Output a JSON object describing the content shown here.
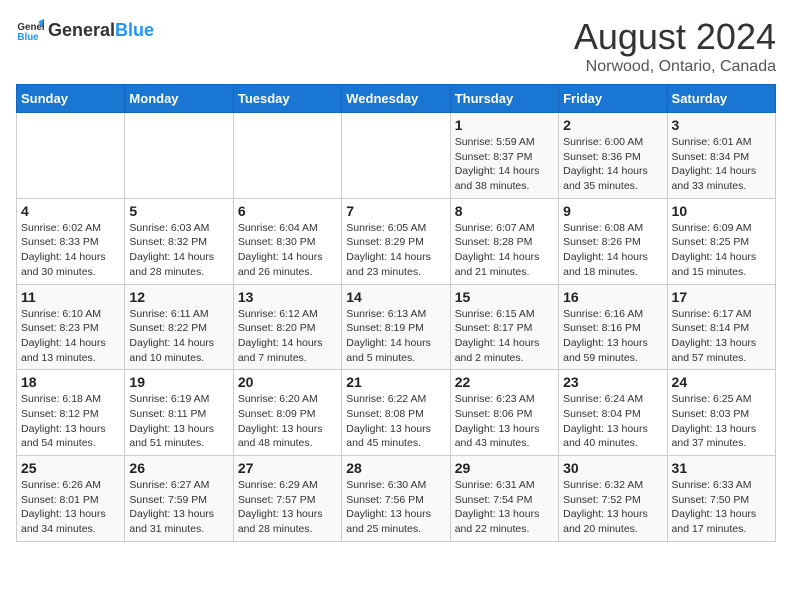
{
  "header": {
    "logo_general": "General",
    "logo_blue": "Blue",
    "title": "August 2024",
    "subtitle": "Norwood, Ontario, Canada"
  },
  "calendar": {
    "days_of_week": [
      "Sunday",
      "Monday",
      "Tuesday",
      "Wednesday",
      "Thursday",
      "Friday",
      "Saturday"
    ],
    "weeks": [
      [
        {
          "day": "",
          "info": ""
        },
        {
          "day": "",
          "info": ""
        },
        {
          "day": "",
          "info": ""
        },
        {
          "day": "",
          "info": ""
        },
        {
          "day": "1",
          "info": "Sunrise: 5:59 AM\nSunset: 8:37 PM\nDaylight: 14 hours\nand 38 minutes."
        },
        {
          "day": "2",
          "info": "Sunrise: 6:00 AM\nSunset: 8:36 PM\nDaylight: 14 hours\nand 35 minutes."
        },
        {
          "day": "3",
          "info": "Sunrise: 6:01 AM\nSunset: 8:34 PM\nDaylight: 14 hours\nand 33 minutes."
        }
      ],
      [
        {
          "day": "4",
          "info": "Sunrise: 6:02 AM\nSunset: 8:33 PM\nDaylight: 14 hours\nand 30 minutes."
        },
        {
          "day": "5",
          "info": "Sunrise: 6:03 AM\nSunset: 8:32 PM\nDaylight: 14 hours\nand 28 minutes."
        },
        {
          "day": "6",
          "info": "Sunrise: 6:04 AM\nSunset: 8:30 PM\nDaylight: 14 hours\nand 26 minutes."
        },
        {
          "day": "7",
          "info": "Sunrise: 6:05 AM\nSunset: 8:29 PM\nDaylight: 14 hours\nand 23 minutes."
        },
        {
          "day": "8",
          "info": "Sunrise: 6:07 AM\nSunset: 8:28 PM\nDaylight: 14 hours\nand 21 minutes."
        },
        {
          "day": "9",
          "info": "Sunrise: 6:08 AM\nSunset: 8:26 PM\nDaylight: 14 hours\nand 18 minutes."
        },
        {
          "day": "10",
          "info": "Sunrise: 6:09 AM\nSunset: 8:25 PM\nDaylight: 14 hours\nand 15 minutes."
        }
      ],
      [
        {
          "day": "11",
          "info": "Sunrise: 6:10 AM\nSunset: 8:23 PM\nDaylight: 14 hours\nand 13 minutes."
        },
        {
          "day": "12",
          "info": "Sunrise: 6:11 AM\nSunset: 8:22 PM\nDaylight: 14 hours\nand 10 minutes."
        },
        {
          "day": "13",
          "info": "Sunrise: 6:12 AM\nSunset: 8:20 PM\nDaylight: 14 hours\nand 7 minutes."
        },
        {
          "day": "14",
          "info": "Sunrise: 6:13 AM\nSunset: 8:19 PM\nDaylight: 14 hours\nand 5 minutes."
        },
        {
          "day": "15",
          "info": "Sunrise: 6:15 AM\nSunset: 8:17 PM\nDaylight: 14 hours\nand 2 minutes."
        },
        {
          "day": "16",
          "info": "Sunrise: 6:16 AM\nSunset: 8:16 PM\nDaylight: 13 hours\nand 59 minutes."
        },
        {
          "day": "17",
          "info": "Sunrise: 6:17 AM\nSunset: 8:14 PM\nDaylight: 13 hours\nand 57 minutes."
        }
      ],
      [
        {
          "day": "18",
          "info": "Sunrise: 6:18 AM\nSunset: 8:12 PM\nDaylight: 13 hours\nand 54 minutes."
        },
        {
          "day": "19",
          "info": "Sunrise: 6:19 AM\nSunset: 8:11 PM\nDaylight: 13 hours\nand 51 minutes."
        },
        {
          "day": "20",
          "info": "Sunrise: 6:20 AM\nSunset: 8:09 PM\nDaylight: 13 hours\nand 48 minutes."
        },
        {
          "day": "21",
          "info": "Sunrise: 6:22 AM\nSunset: 8:08 PM\nDaylight: 13 hours\nand 45 minutes."
        },
        {
          "day": "22",
          "info": "Sunrise: 6:23 AM\nSunset: 8:06 PM\nDaylight: 13 hours\nand 43 minutes."
        },
        {
          "day": "23",
          "info": "Sunrise: 6:24 AM\nSunset: 8:04 PM\nDaylight: 13 hours\nand 40 minutes."
        },
        {
          "day": "24",
          "info": "Sunrise: 6:25 AM\nSunset: 8:03 PM\nDaylight: 13 hours\nand 37 minutes."
        }
      ],
      [
        {
          "day": "25",
          "info": "Sunrise: 6:26 AM\nSunset: 8:01 PM\nDaylight: 13 hours\nand 34 minutes."
        },
        {
          "day": "26",
          "info": "Sunrise: 6:27 AM\nSunset: 7:59 PM\nDaylight: 13 hours\nand 31 minutes."
        },
        {
          "day": "27",
          "info": "Sunrise: 6:29 AM\nSunset: 7:57 PM\nDaylight: 13 hours\nand 28 minutes."
        },
        {
          "day": "28",
          "info": "Sunrise: 6:30 AM\nSunset: 7:56 PM\nDaylight: 13 hours\nand 25 minutes."
        },
        {
          "day": "29",
          "info": "Sunrise: 6:31 AM\nSunset: 7:54 PM\nDaylight: 13 hours\nand 22 minutes."
        },
        {
          "day": "30",
          "info": "Sunrise: 6:32 AM\nSunset: 7:52 PM\nDaylight: 13 hours\nand 20 minutes."
        },
        {
          "day": "31",
          "info": "Sunrise: 6:33 AM\nSunset: 7:50 PM\nDaylight: 13 hours\nand 17 minutes."
        }
      ]
    ]
  }
}
